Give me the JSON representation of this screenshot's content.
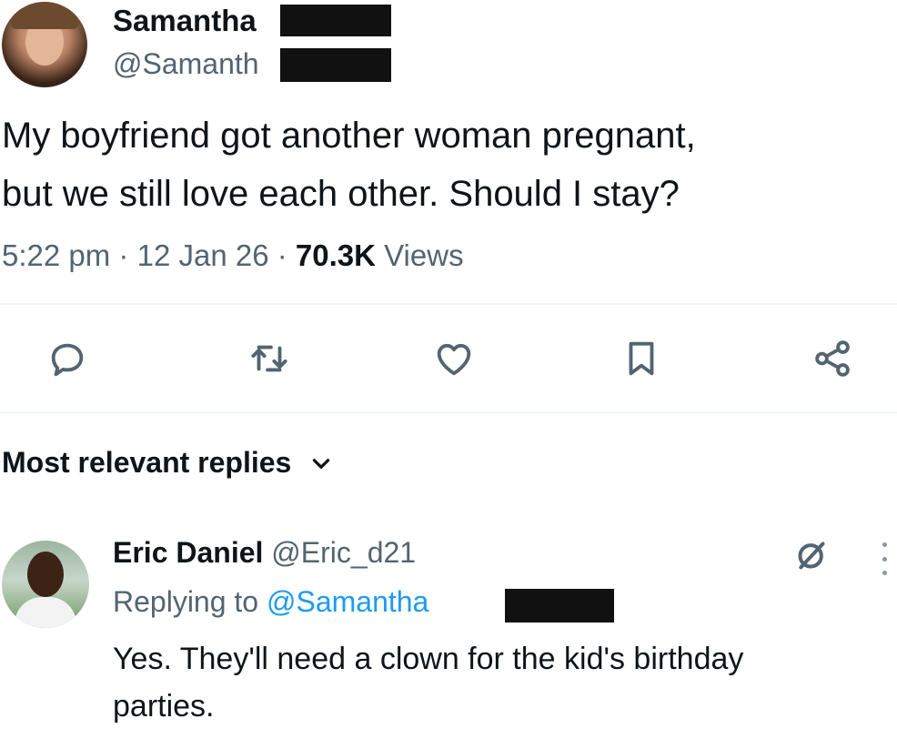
{
  "tweet": {
    "author_name": "Samantha",
    "author_handle": "@Samanth",
    "text_line1": "My boyfriend got another woman pregnant,",
    "text_line2": "but we still love each other. Should I stay?",
    "time": "5:22 pm",
    "date": "12 Jan 26",
    "views_count": "70.3K",
    "views_label": "Views"
  },
  "actions": {
    "reply_icon": "reply-icon",
    "retweet_icon": "retweet-icon",
    "like_icon": "heart-icon",
    "bookmark_icon": "bookmark-icon",
    "share_icon": "share-icon"
  },
  "replies_header": "Most relevant replies",
  "reply": {
    "author_name": "Eric Daniel",
    "author_handle": "@Eric_d21",
    "replying_to_label": "Replying to",
    "replying_to_handle": "@Samantha",
    "text_line1": "Yes. They'll need a clown for the kid's birthday",
    "text_line2": "parties."
  },
  "colors": {
    "text": "#0f1419",
    "secondary": "#536471",
    "link": "#1d9bf0",
    "divider": "#eff3f4"
  }
}
